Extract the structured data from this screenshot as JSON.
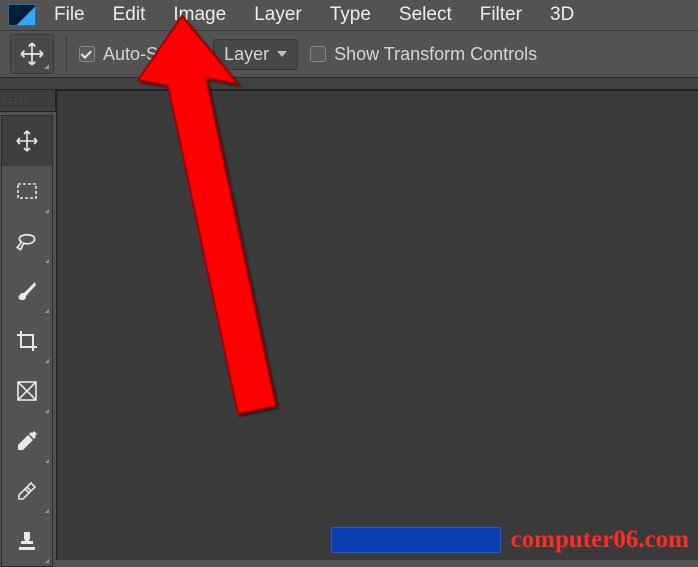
{
  "menubar": {
    "items": [
      "File",
      "Edit",
      "Image",
      "Layer",
      "Type",
      "Select",
      "Filter",
      "3D"
    ]
  },
  "options": {
    "auto_select_label": "Auto-Select:",
    "layer_dropdown": "Layer",
    "show_transform_label": "Show Transform Controls",
    "auto_select_checked": true,
    "show_transform_checked": false
  },
  "tools": [
    {
      "name": "move-tool",
      "icon": "move"
    },
    {
      "name": "marquee-tool",
      "icon": "marquee"
    },
    {
      "name": "lasso-tool",
      "icon": "lasso"
    },
    {
      "name": "brush-tool",
      "icon": "brush"
    },
    {
      "name": "crop-tool",
      "icon": "crop"
    },
    {
      "name": "frame-tool",
      "icon": "frame"
    },
    {
      "name": "eyedropper-tool",
      "icon": "eyedropper"
    },
    {
      "name": "healing-brush-tool",
      "icon": "healing"
    },
    {
      "name": "clone-stamp-tool",
      "icon": "stamp"
    }
  ],
  "watermark": {
    "text": "computer06.com"
  }
}
